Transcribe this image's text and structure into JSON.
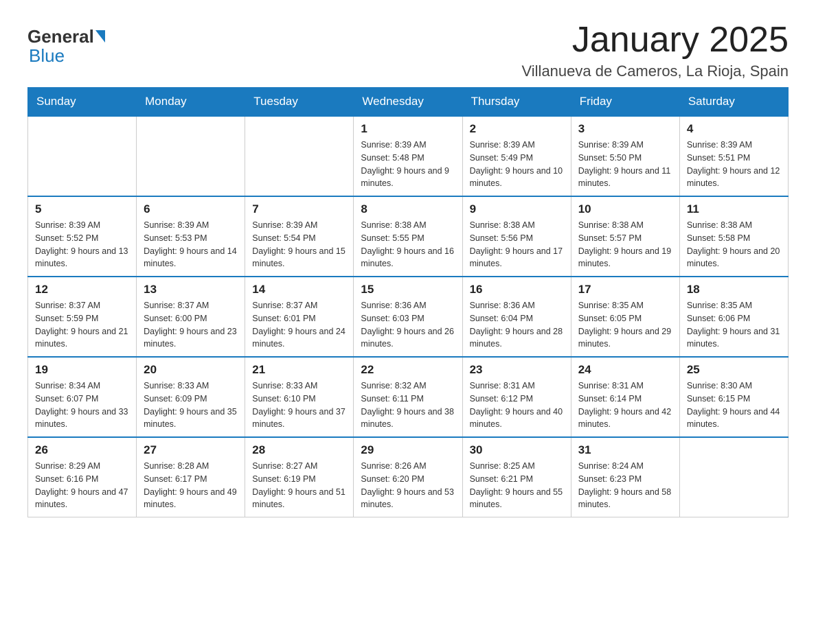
{
  "logo": {
    "general": "General",
    "blue": "Blue"
  },
  "header": {
    "month": "January 2025",
    "location": "Villanueva de Cameros, La Rioja, Spain"
  },
  "days_of_week": [
    "Sunday",
    "Monday",
    "Tuesday",
    "Wednesday",
    "Thursday",
    "Friday",
    "Saturday"
  ],
  "weeks": [
    [
      null,
      null,
      null,
      {
        "day": "1",
        "sunrise": "Sunrise: 8:39 AM",
        "sunset": "Sunset: 5:48 PM",
        "daylight": "Daylight: 9 hours and 9 minutes."
      },
      {
        "day": "2",
        "sunrise": "Sunrise: 8:39 AM",
        "sunset": "Sunset: 5:49 PM",
        "daylight": "Daylight: 9 hours and 10 minutes."
      },
      {
        "day": "3",
        "sunrise": "Sunrise: 8:39 AM",
        "sunset": "Sunset: 5:50 PM",
        "daylight": "Daylight: 9 hours and 11 minutes."
      },
      {
        "day": "4",
        "sunrise": "Sunrise: 8:39 AM",
        "sunset": "Sunset: 5:51 PM",
        "daylight": "Daylight: 9 hours and 12 minutes."
      }
    ],
    [
      {
        "day": "5",
        "sunrise": "Sunrise: 8:39 AM",
        "sunset": "Sunset: 5:52 PM",
        "daylight": "Daylight: 9 hours and 13 minutes."
      },
      {
        "day": "6",
        "sunrise": "Sunrise: 8:39 AM",
        "sunset": "Sunset: 5:53 PM",
        "daylight": "Daylight: 9 hours and 14 minutes."
      },
      {
        "day": "7",
        "sunrise": "Sunrise: 8:39 AM",
        "sunset": "Sunset: 5:54 PM",
        "daylight": "Daylight: 9 hours and 15 minutes."
      },
      {
        "day": "8",
        "sunrise": "Sunrise: 8:38 AM",
        "sunset": "Sunset: 5:55 PM",
        "daylight": "Daylight: 9 hours and 16 minutes."
      },
      {
        "day": "9",
        "sunrise": "Sunrise: 8:38 AM",
        "sunset": "Sunset: 5:56 PM",
        "daylight": "Daylight: 9 hours and 17 minutes."
      },
      {
        "day": "10",
        "sunrise": "Sunrise: 8:38 AM",
        "sunset": "Sunset: 5:57 PM",
        "daylight": "Daylight: 9 hours and 19 minutes."
      },
      {
        "day": "11",
        "sunrise": "Sunrise: 8:38 AM",
        "sunset": "Sunset: 5:58 PM",
        "daylight": "Daylight: 9 hours and 20 minutes."
      }
    ],
    [
      {
        "day": "12",
        "sunrise": "Sunrise: 8:37 AM",
        "sunset": "Sunset: 5:59 PM",
        "daylight": "Daylight: 9 hours and 21 minutes."
      },
      {
        "day": "13",
        "sunrise": "Sunrise: 8:37 AM",
        "sunset": "Sunset: 6:00 PM",
        "daylight": "Daylight: 9 hours and 23 minutes."
      },
      {
        "day": "14",
        "sunrise": "Sunrise: 8:37 AM",
        "sunset": "Sunset: 6:01 PM",
        "daylight": "Daylight: 9 hours and 24 minutes."
      },
      {
        "day": "15",
        "sunrise": "Sunrise: 8:36 AM",
        "sunset": "Sunset: 6:03 PM",
        "daylight": "Daylight: 9 hours and 26 minutes."
      },
      {
        "day": "16",
        "sunrise": "Sunrise: 8:36 AM",
        "sunset": "Sunset: 6:04 PM",
        "daylight": "Daylight: 9 hours and 28 minutes."
      },
      {
        "day": "17",
        "sunrise": "Sunrise: 8:35 AM",
        "sunset": "Sunset: 6:05 PM",
        "daylight": "Daylight: 9 hours and 29 minutes."
      },
      {
        "day": "18",
        "sunrise": "Sunrise: 8:35 AM",
        "sunset": "Sunset: 6:06 PM",
        "daylight": "Daylight: 9 hours and 31 minutes."
      }
    ],
    [
      {
        "day": "19",
        "sunrise": "Sunrise: 8:34 AM",
        "sunset": "Sunset: 6:07 PM",
        "daylight": "Daylight: 9 hours and 33 minutes."
      },
      {
        "day": "20",
        "sunrise": "Sunrise: 8:33 AM",
        "sunset": "Sunset: 6:09 PM",
        "daylight": "Daylight: 9 hours and 35 minutes."
      },
      {
        "day": "21",
        "sunrise": "Sunrise: 8:33 AM",
        "sunset": "Sunset: 6:10 PM",
        "daylight": "Daylight: 9 hours and 37 minutes."
      },
      {
        "day": "22",
        "sunrise": "Sunrise: 8:32 AM",
        "sunset": "Sunset: 6:11 PM",
        "daylight": "Daylight: 9 hours and 38 minutes."
      },
      {
        "day": "23",
        "sunrise": "Sunrise: 8:31 AM",
        "sunset": "Sunset: 6:12 PM",
        "daylight": "Daylight: 9 hours and 40 minutes."
      },
      {
        "day": "24",
        "sunrise": "Sunrise: 8:31 AM",
        "sunset": "Sunset: 6:14 PM",
        "daylight": "Daylight: 9 hours and 42 minutes."
      },
      {
        "day": "25",
        "sunrise": "Sunrise: 8:30 AM",
        "sunset": "Sunset: 6:15 PM",
        "daylight": "Daylight: 9 hours and 44 minutes."
      }
    ],
    [
      {
        "day": "26",
        "sunrise": "Sunrise: 8:29 AM",
        "sunset": "Sunset: 6:16 PM",
        "daylight": "Daylight: 9 hours and 47 minutes."
      },
      {
        "day": "27",
        "sunrise": "Sunrise: 8:28 AM",
        "sunset": "Sunset: 6:17 PM",
        "daylight": "Daylight: 9 hours and 49 minutes."
      },
      {
        "day": "28",
        "sunrise": "Sunrise: 8:27 AM",
        "sunset": "Sunset: 6:19 PM",
        "daylight": "Daylight: 9 hours and 51 minutes."
      },
      {
        "day": "29",
        "sunrise": "Sunrise: 8:26 AM",
        "sunset": "Sunset: 6:20 PM",
        "daylight": "Daylight: 9 hours and 53 minutes."
      },
      {
        "day": "30",
        "sunrise": "Sunrise: 8:25 AM",
        "sunset": "Sunset: 6:21 PM",
        "daylight": "Daylight: 9 hours and 55 minutes."
      },
      {
        "day": "31",
        "sunrise": "Sunrise: 8:24 AM",
        "sunset": "Sunset: 6:23 PM",
        "daylight": "Daylight: 9 hours and 58 minutes."
      },
      null
    ]
  ]
}
